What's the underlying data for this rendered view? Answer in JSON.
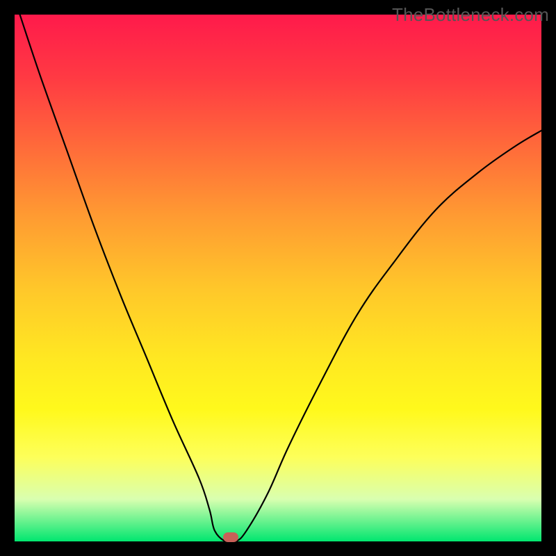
{
  "watermark": "TheBottleneck.com",
  "chart_data": {
    "type": "line",
    "title": "",
    "xlabel": "",
    "ylabel": "",
    "xlim": [
      0,
      100
    ],
    "ylim": [
      0,
      100
    ],
    "grid": false,
    "series": [
      {
        "name": "curve",
        "x": [
          1,
          5,
          10,
          15,
          20,
          25,
          30,
          35,
          37,
          38,
          40,
          42,
          44,
          48,
          52,
          58,
          65,
          72,
          80,
          88,
          95,
          100
        ],
        "values": [
          100,
          88,
          74,
          60,
          47,
          35,
          23,
          12,
          6,
          2,
          0,
          0,
          2,
          9,
          18,
          30,
          43,
          53,
          63,
          70,
          75,
          78
        ]
      }
    ],
    "marker": {
      "x": 41,
      "y": 0.8,
      "color": "#c86058"
    },
    "background_gradient": {
      "top": "#ff1a4b",
      "mid": "#ffe722",
      "bottom": "#00e66f"
    }
  }
}
